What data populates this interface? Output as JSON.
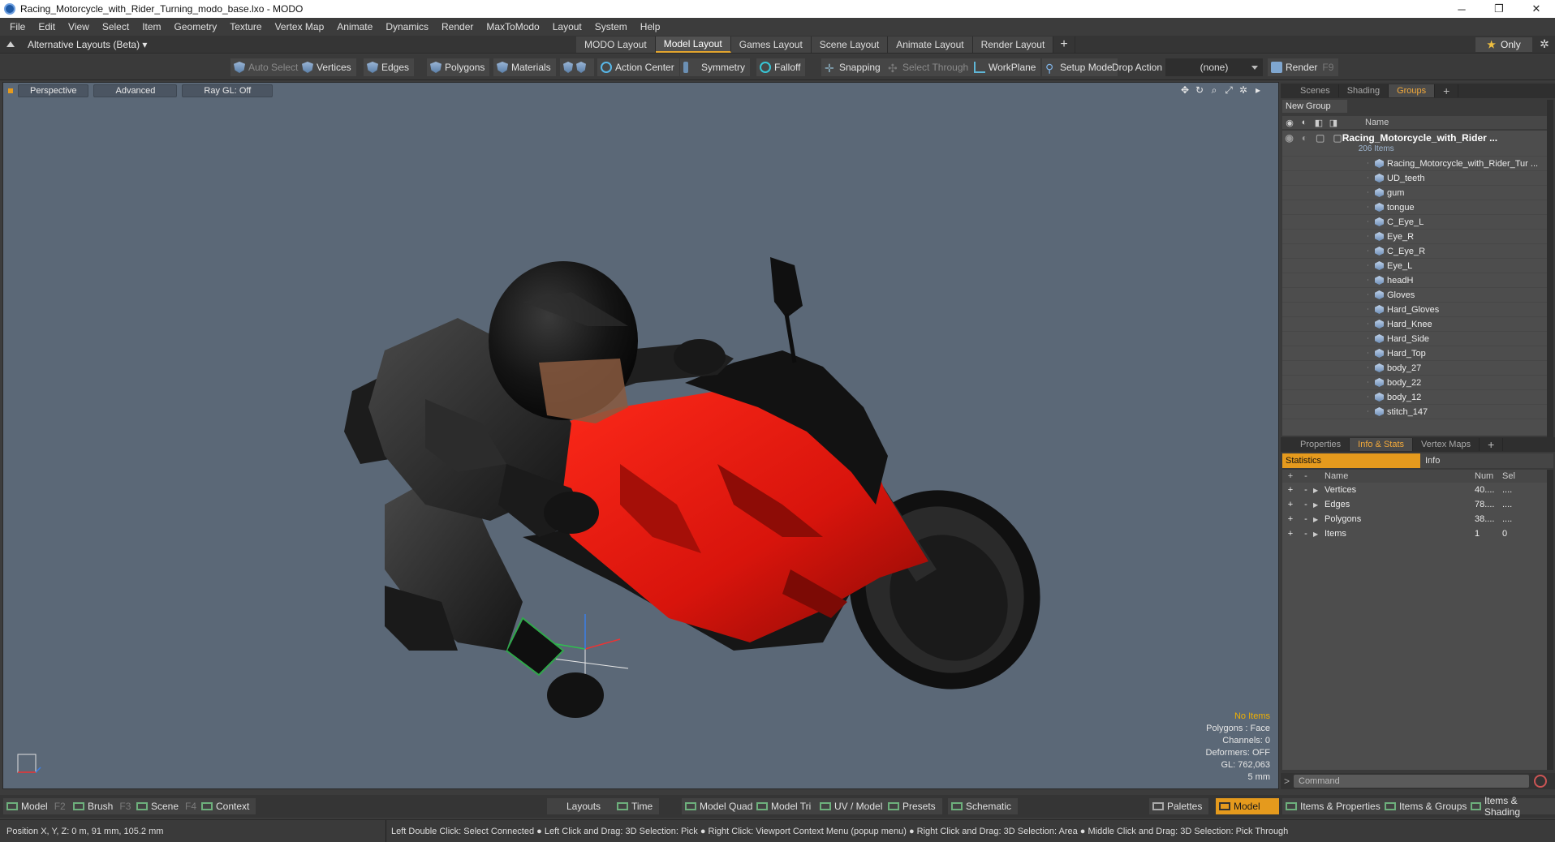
{
  "window": {
    "title": "Racing_Motorcycle_with_Rider_Turning_modo_base.lxo - MODO",
    "minimize": "─",
    "maximize": "❐",
    "close": "✕"
  },
  "menubar": [
    "File",
    "Edit",
    "View",
    "Select",
    "Item",
    "Geometry",
    "Texture",
    "Vertex Map",
    "Animate",
    "Dynamics",
    "Render",
    "MaxToModo",
    "Layout",
    "System",
    "Help"
  ],
  "layoutbar": {
    "alt_layouts": "Alternative Layouts (Beta) ▾",
    "tabs": [
      "MODO Layout",
      "Model Layout",
      "Games Layout",
      "Scene Layout",
      "Animate Layout",
      "Render Layout"
    ],
    "active_tab": "Model Layout",
    "add": "+",
    "only": "Only",
    "star": "★",
    "gear": "✲"
  },
  "toolbar": {
    "auto_select": "Auto Select",
    "vertices": "Vertices",
    "edges": "Edges",
    "polygons": "Polygons",
    "materials": "Materials",
    "action_center": "Action Center",
    "symmetry": "Symmetry",
    "falloff": "Falloff",
    "snapping": "Snapping",
    "select_through": "Select Through",
    "workplane": "WorkPlane",
    "setup_mode": "Setup Mode",
    "drop_action": "Drop Action",
    "drop_value": "(none)",
    "render": "Render",
    "render_key": "F9"
  },
  "viewport": {
    "perspective": "Perspective",
    "advanced": "Advanced",
    "raygl": "Ray GL: Off",
    "info": {
      "no_items": "No Items",
      "polygons": "Polygons : Face",
      "channels": "Channels: 0",
      "deformers": "Deformers: OFF",
      "gl": "GL: 762,063",
      "scale": "5 mm"
    }
  },
  "groups_panel": {
    "tabs": [
      "Scenes",
      "Shading",
      "Groups"
    ],
    "active_tab": "Groups",
    "new_group": "New Group",
    "name_header": "Name",
    "root": {
      "name": "Racing_Motorcycle_with_Rider ...",
      "count": "206 Items"
    },
    "items": [
      "Racing_Motorcycle_with_Rider_Tur ...",
      "UD_teeth",
      "gum",
      "tongue",
      "C_Eye_L",
      "Eye_R",
      "C_Eye_R",
      "Eye_L",
      "headH",
      "Gloves",
      "Hard_Gloves",
      "Hard_Knee",
      "Hard_Side",
      "Hard_Top",
      "body_27",
      "body_22",
      "body_12",
      "stitch_147"
    ]
  },
  "stats_panel": {
    "tabs": [
      "Properties",
      "Info & Stats",
      "Vertex Maps"
    ],
    "active_tab": "Info & Stats",
    "statistics": "Statistics",
    "info": "Info",
    "headers": {
      "name": "Name",
      "num": "Num",
      "sel": "Sel"
    },
    "rows": [
      {
        "name": "Vertices",
        "num": "40....",
        "sel": "...."
      },
      {
        "name": "Edges",
        "num": "78....",
        "sel": "...."
      },
      {
        "name": "Polygons",
        "num": "38....",
        "sel": "...."
      },
      {
        "name": "Items",
        "num": "1",
        "sel": "0"
      }
    ],
    "command_placeholder": "Command"
  },
  "bottombar": {
    "model": "Model",
    "model_key": "F2",
    "brush": "Brush",
    "brush_key": "F3",
    "scene": "Scene",
    "scene_key": "F4",
    "context": "Context",
    "layouts": "Layouts",
    "time": "Time",
    "model_quad": "Model Quad",
    "model_tri": "Model Tri",
    "uv_model": "UV / Model",
    "presets": "Presets",
    "schematic": "Schematic",
    "palettes": "Palettes",
    "model_right": "Model",
    "items_properties": "Items & Properties",
    "items_groups": "Items & Groups",
    "items_shading": "Items & Shading"
  },
  "statusbar": {
    "position": "Position X, Y, Z:   0 m, 91 mm, 105.2 mm",
    "hint": "Left Double Click: Select Connected ● Left Click and Drag: 3D Selection: Pick ● Right Click: Viewport Context Menu (popup menu) ● Right Click and Drag: 3D Selection: Area ● Middle Click and Drag: 3D Selection: Pick Through"
  },
  "colors": {
    "accent": "#e59a1d",
    "viewport_bg": "#5b6877",
    "bike_red": "#e11a12"
  }
}
